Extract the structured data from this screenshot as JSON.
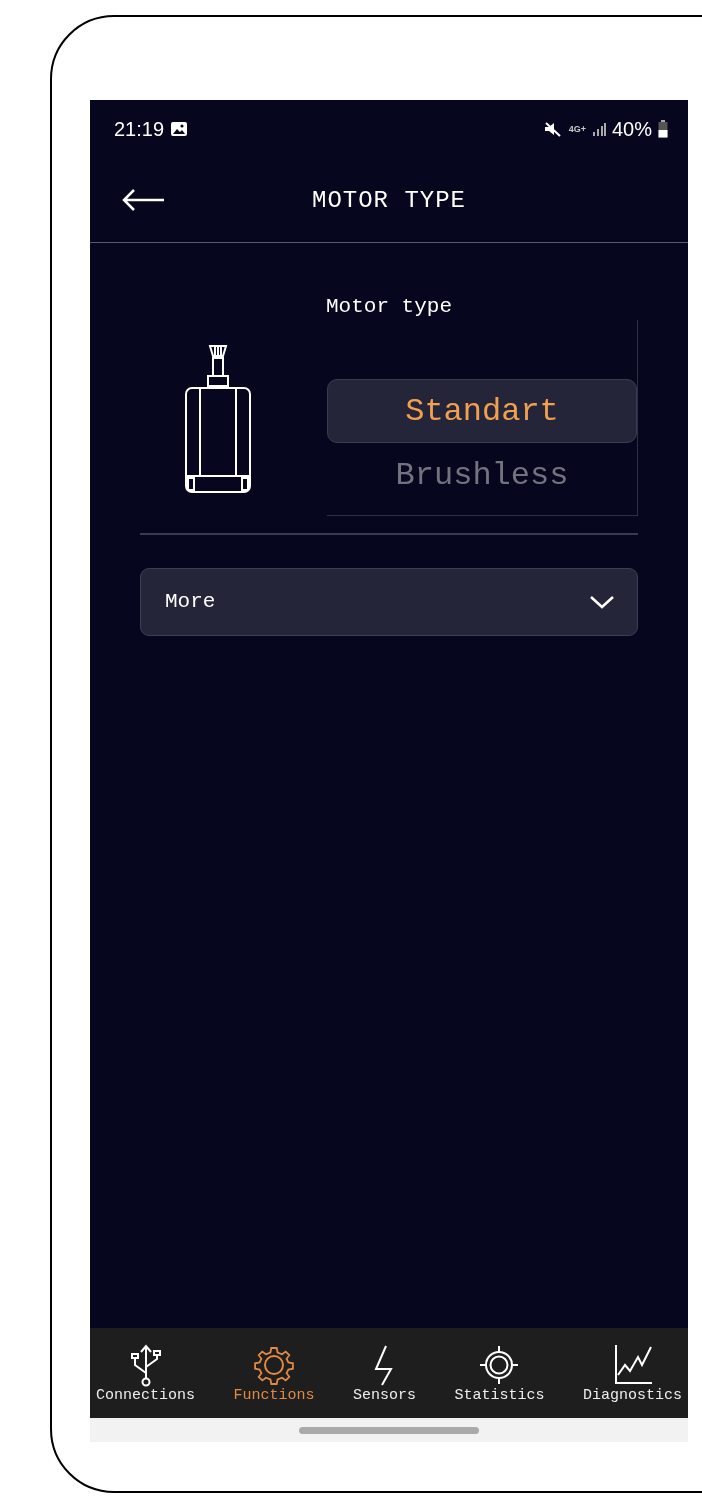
{
  "status_bar": {
    "time": "21:19",
    "network": "4G+",
    "battery": "40%"
  },
  "header": {
    "title": "MOTOR TYPE"
  },
  "motor_type": {
    "label": "Motor type",
    "options": [
      {
        "label": "Standart",
        "selected": true
      },
      {
        "label": "Brushless",
        "selected": false
      }
    ]
  },
  "more": {
    "label": "More",
    "expanded": false
  },
  "nav": {
    "items": [
      {
        "label": "Connections",
        "selected": false
      },
      {
        "label": "Functions",
        "selected": true
      },
      {
        "label": "Sensors",
        "selected": false
      },
      {
        "label": "Statistics",
        "selected": false
      },
      {
        "label": "Diagnostics",
        "selected": false
      }
    ]
  }
}
